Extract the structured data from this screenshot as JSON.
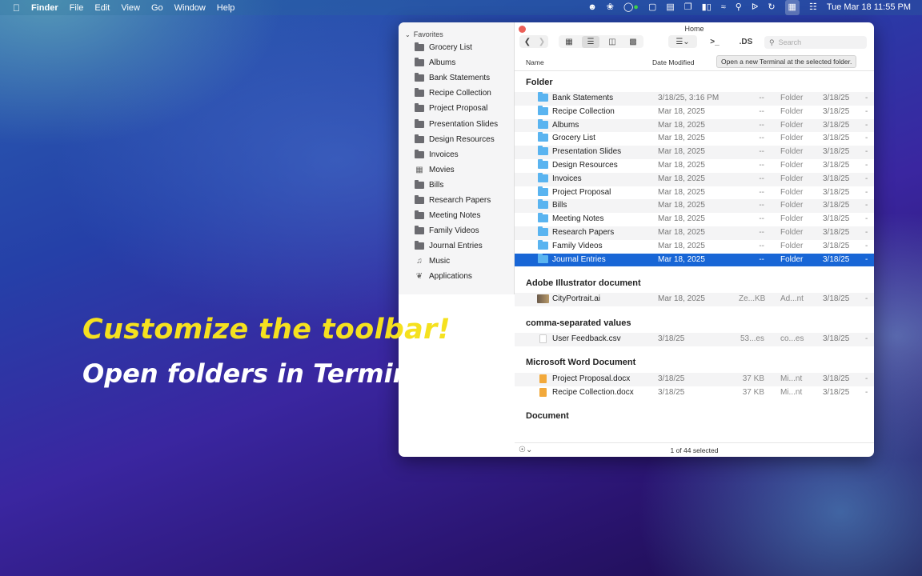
{
  "menubar": {
    "apple": "",
    "app": "Finder",
    "menus": [
      "File",
      "Edit",
      "View",
      "Go",
      "Window",
      "Help"
    ],
    "clock": "Tue Mar 18  11:55 PM"
  },
  "window": {
    "title": "Home",
    "tooltip": "Open a new Terminal at the selected folder.",
    "search_placeholder": "Search",
    "ds_label": ".DS",
    "terminal_label": ">_",
    "columns": {
      "name": "Name",
      "date": "Date Modified"
    },
    "status": "1 of 44 selected"
  },
  "sidebar": {
    "heading": "Favorites",
    "items": [
      {
        "label": "Grocery List",
        "icon": "folder-icon"
      },
      {
        "label": "Albums",
        "icon": "folder-icon"
      },
      {
        "label": "Bank Statements",
        "icon": "folder-icon"
      },
      {
        "label": "Recipe Collection",
        "icon": "folder-icon"
      },
      {
        "label": "Project Proposal",
        "icon": "folder-icon"
      },
      {
        "label": "Presentation Slides",
        "icon": "folder-icon"
      },
      {
        "label": "Design Resources",
        "icon": "folder-icon"
      },
      {
        "label": "Invoices",
        "icon": "folder-icon"
      },
      {
        "label": "Movies",
        "icon": "film-icon"
      },
      {
        "label": "Bills",
        "icon": "folder-icon"
      },
      {
        "label": "Research Papers",
        "icon": "folder-icon"
      },
      {
        "label": "Meeting Notes",
        "icon": "folder-icon"
      },
      {
        "label": "Family Videos",
        "icon": "folder-icon"
      },
      {
        "label": "Journal Entries",
        "icon": "folder-icon"
      },
      {
        "label": "Music",
        "icon": "music-note-icon"
      },
      {
        "label": "Applications",
        "icon": "applications-icon"
      }
    ]
  },
  "groups": [
    {
      "title": "Folder",
      "rows": [
        {
          "name": "Bank Statements",
          "date": "3/18/25, 3:16 PM",
          "size": "--",
          "kind": "Folder",
          "added": "3/18/25",
          "dash": "-"
        },
        {
          "name": "Recipe Collection",
          "date": "Mar 18, 2025",
          "size": "--",
          "kind": "Folder",
          "added": "3/18/25",
          "dash": "-"
        },
        {
          "name": "Albums",
          "date": "Mar 18, 2025",
          "size": "--",
          "kind": "Folder",
          "added": "3/18/25",
          "dash": "-"
        },
        {
          "name": "Grocery List",
          "date": "Mar 18, 2025",
          "size": "--",
          "kind": "Folder",
          "added": "3/18/25",
          "dash": "-"
        },
        {
          "name": "Presentation Slides",
          "date": "Mar 18, 2025",
          "size": "--",
          "kind": "Folder",
          "added": "3/18/25",
          "dash": "-"
        },
        {
          "name": "Design Resources",
          "date": "Mar 18, 2025",
          "size": "--",
          "kind": "Folder",
          "added": "3/18/25",
          "dash": "-"
        },
        {
          "name": "Invoices",
          "date": "Mar 18, 2025",
          "size": "--",
          "kind": "Folder",
          "added": "3/18/25",
          "dash": "-"
        },
        {
          "name": "Project Proposal",
          "date": "Mar 18, 2025",
          "size": "--",
          "kind": "Folder",
          "added": "3/18/25",
          "dash": "-"
        },
        {
          "name": "Bills",
          "date": "Mar 18, 2025",
          "size": "--",
          "kind": "Folder",
          "added": "3/18/25",
          "dash": "-"
        },
        {
          "name": "Meeting Notes",
          "date": "Mar 18, 2025",
          "size": "--",
          "kind": "Folder",
          "added": "3/18/25",
          "dash": "-"
        },
        {
          "name": "Research Papers",
          "date": "Mar 18, 2025",
          "size": "--",
          "kind": "Folder",
          "added": "3/18/25",
          "dash": "-"
        },
        {
          "name": "Family Videos",
          "date": "Mar 18, 2025",
          "size": "--",
          "kind": "Folder",
          "added": "3/18/25",
          "dash": "-"
        },
        {
          "name": "Journal Entries",
          "date": "Mar 18, 2025",
          "size": "--",
          "kind": "Folder",
          "added": "3/18/25",
          "dash": "-",
          "selected": true
        }
      ]
    },
    {
      "title": "Adobe Illustrator document",
      "rows": [
        {
          "name": "CityPortrait.ai",
          "date": "Mar 18, 2025",
          "size": "Ze...KB",
          "kind": "Ad...nt",
          "added": "3/18/25",
          "dash": "-",
          "icon": "image"
        }
      ]
    },
    {
      "title": "comma-separated values",
      "rows": [
        {
          "name": "User Feedback.csv",
          "date": "3/18/25",
          "size": "53...es",
          "kind": "co...es",
          "added": "3/18/25",
          "dash": "-",
          "icon": "csv"
        }
      ]
    },
    {
      "title": "Microsoft Word Document",
      "rows": [
        {
          "name": "Project Proposal.docx",
          "date": "3/18/25",
          "size": "37 KB",
          "kind": "Mi...nt",
          "added": "3/18/25",
          "dash": "-",
          "icon": "docx"
        },
        {
          "name": "Recipe Collection.docx",
          "date": "3/18/25",
          "size": "37 KB",
          "kind": "Mi...nt",
          "added": "3/18/25",
          "dash": "-",
          "icon": "docx"
        }
      ]
    },
    {
      "title": "Document",
      "rows": []
    }
  ],
  "promo": {
    "line1": "Customize the toolbar!",
    "line2": "Open folders in Terminal"
  },
  "colors": {
    "selection": "#1866d6",
    "folder": "#5ab4f0",
    "headline": "#f5e11f"
  }
}
